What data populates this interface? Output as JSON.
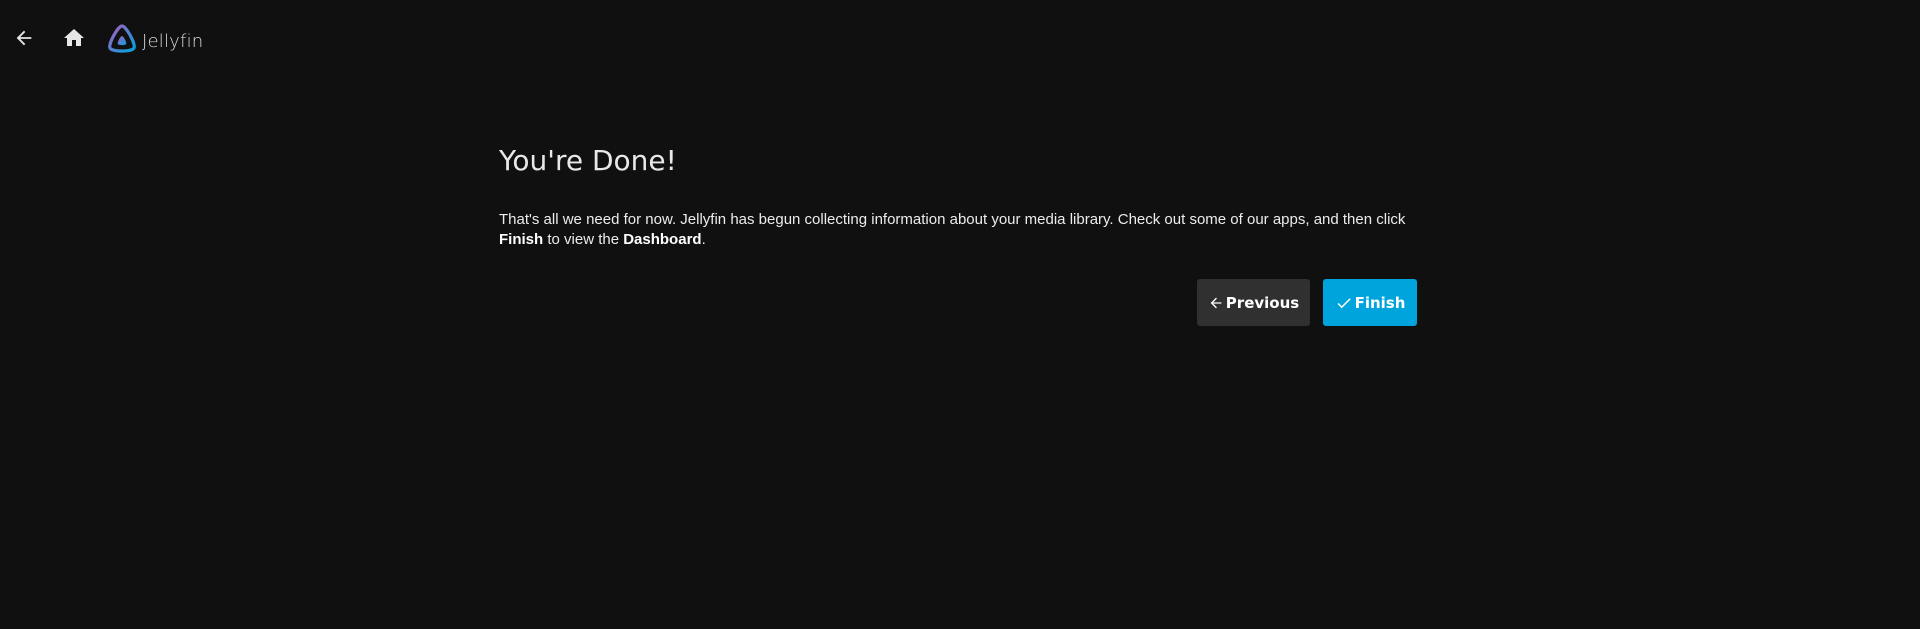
{
  "header": {
    "back_icon": "arrow-left-icon",
    "home_icon": "home-icon",
    "logo_text": "Jellyfin"
  },
  "wizard": {
    "title": "You're Done!",
    "para_part1": "That's all we need for now. Jellyfin has begun collecting information about your media library. Check out some of our apps, and then click ",
    "para_bold1": "Finish",
    "para_part2": " to view the ",
    "para_bold2": "Dashboard",
    "para_part3": "."
  },
  "buttons": {
    "previous_label": "Previous",
    "previous_icon": "arrow-left-icon",
    "finish_label": "Finish",
    "finish_icon": "check-icon"
  },
  "colors": {
    "background": "#101010",
    "accent": "#00a4dc",
    "secondary_button": "#303030",
    "logo_gradient_start": "#aa5cc3",
    "logo_gradient_end": "#00a4dc"
  }
}
